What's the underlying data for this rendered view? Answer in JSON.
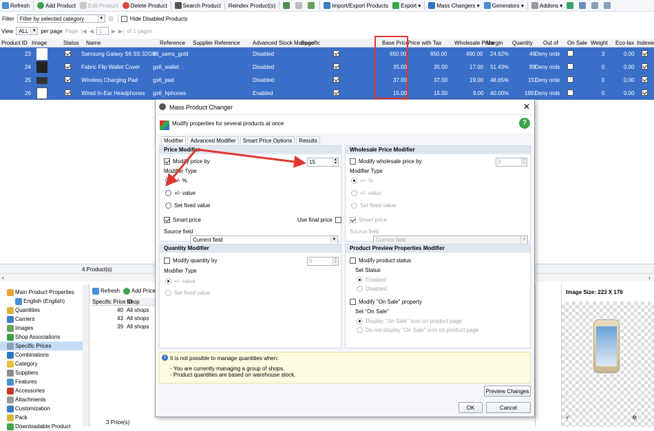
{
  "toolbar": {
    "refresh": "Refresh",
    "add_product": "Add Product",
    "edit_product": "Edit Product",
    "delete_product": "Delete Product",
    "search_product": "Search Product",
    "reindex": "Reindex Product(s)",
    "import_export": "Import/Export Products",
    "export": "Export",
    "mass_changers": "Mass Changers",
    "generators": "Generators",
    "addons": "Addons"
  },
  "filter": {
    "label": "Filter",
    "value": "Filter by selected category",
    "hide_disabled": "Hide Disabled Products"
  },
  "pager": {
    "view": "View",
    "view_value": "ALL",
    "per_page": "per page",
    "page": "Page",
    "page_value": "1",
    "of_pages": "of 1 pages"
  },
  "grid": {
    "columns": [
      "Product ID",
      "Image",
      "Status",
      "Name",
      "Reference",
      "Supplier Reference",
      "Advanced Stock Manage",
      "Specific",
      "Base Price",
      "Price with Tax",
      "Wholesale Price",
      "Margin",
      "Quantity",
      "Out of S",
      "On Sale",
      "Weight",
      "Eco-tax",
      "Indexed"
    ],
    "rows": [
      {
        "id": "23",
        "name": "Samsung Galaxy S6 SS 32GB G920 G",
        "ref": "s6_sams_gold",
        "asm": "Disabled",
        "base": "650.00",
        "tax": "650.00",
        "whole": "490.00",
        "margin": "24.62%",
        "qty": "46",
        "oos": "Deny orders",
        "weight": "3",
        "eco": "0.00"
      },
      {
        "id": "24",
        "name": "Fabric Flip Wallet Cover",
        "ref": "gs6_wallet",
        "asm": "Disabled",
        "base": "35.00",
        "tax": "35.00",
        "whole": "17.00",
        "margin": "51.43%",
        "qty": "99",
        "oos": "Deny orders",
        "weight": "0",
        "eco": "0.00"
      },
      {
        "id": "25",
        "name": "Wireless Charging Pad",
        "ref": "gs6_pad",
        "asm": "Disabled",
        "base": "37.00",
        "tax": "37.00",
        "whole": "19.00",
        "margin": "48.65%",
        "qty": "151",
        "oos": "Deny orders",
        "weight": "0",
        "eco": "0.00"
      },
      {
        "id": "26",
        "name": "Wired In-Ear Headphones",
        "ref": "gs6_hphones",
        "asm": "Enabled",
        "base": "15.00",
        "tax": "15.00",
        "whole": "9.00",
        "margin": "40.00%",
        "qty": "1991",
        "oos": "Deny orders",
        "weight": "0",
        "eco": "0.00"
      }
    ],
    "count": "4 Product(s)"
  },
  "left": {
    "tree": [
      "Main Product Properties",
      "English (English)",
      "Quantities",
      "Carriers",
      "Images",
      "Shop Associations",
      "Specific Prices",
      "Combinations",
      "Category",
      "Suppliers",
      "Features",
      "Accessories",
      "Attachments",
      "Customization",
      "Pack",
      "Downloadable Product"
    ],
    "sub_refresh": "Refresh",
    "sub_add": "Add Price",
    "sub_cols": [
      "Specific Price ID",
      "Shop"
    ],
    "sub_rows": [
      {
        "id": "40",
        "shop": "All shops"
      },
      {
        "id": "43",
        "shop": "All shops"
      },
      {
        "id": "39",
        "shop": "All shops"
      }
    ],
    "price_count": "3 Price(s)"
  },
  "image_panel": {
    "size": "Image Size: 223 X 176"
  },
  "dialog": {
    "title": "Mass Product Changer",
    "subtitle": "Modify properties for several products at once",
    "tabs": [
      "Modifier",
      "Advanced Modifier",
      "Smart Price Options",
      "Results"
    ],
    "price_modifier": {
      "title": "Price Modifier",
      "modify": "Modify price by",
      "value": "15",
      "type_label": "Modifier Type",
      "opt_percent": "+/- %",
      "opt_value": "+/- value",
      "opt_fixed": "Set fixed value",
      "smart_price": "Smart price",
      "use_final": "Use final price",
      "source_label": "Source field",
      "source_value": "Current field"
    },
    "wholesale_modifier": {
      "title": "Wholesale Price Modifier",
      "modify": "Modify wholesale price by",
      "value": "0",
      "type_label": "Modifier Type",
      "opt_percent": "+/- %",
      "opt_value": "+/- value",
      "opt_fixed": "Set fixed value",
      "smart_price": "Smart price",
      "source_label": "Source field",
      "source_value": "Current field"
    },
    "quantity_modifier": {
      "title": "Quantity Modifier",
      "modify": "Modify quantity by",
      "value": "0",
      "type_label": "Modifier Type",
      "opt_value": "+/- value",
      "opt_fixed": "Set fixed value"
    },
    "preview_modifier": {
      "title": "Product Preview Properties Modifier",
      "status": "Modify product status",
      "set_status": "Set Status",
      "enabled": "Enabled",
      "disabled": "Disabled",
      "on_sale": "Modify \"On Sale\" property",
      "set_on_sale": "Set \"On Sale\"",
      "display": "Display \"On Sale\" icon on product page",
      "not_display": "Do not display \"On Sale\" icon on product page"
    },
    "info": {
      "line1": "It is not possible to manage quantities when:",
      "line2": "- You are currently managing a group of shops.",
      "line3": "- Product quantities are based on warehouse stock."
    },
    "preview_button": "Preview Changes",
    "ok": "OK",
    "cancel": "Cancel"
  },
  "colors": {
    "row_blue": "#3a6fc9",
    "highlight": "#e2352e",
    "selected_tree": "#c6dcf5"
  }
}
